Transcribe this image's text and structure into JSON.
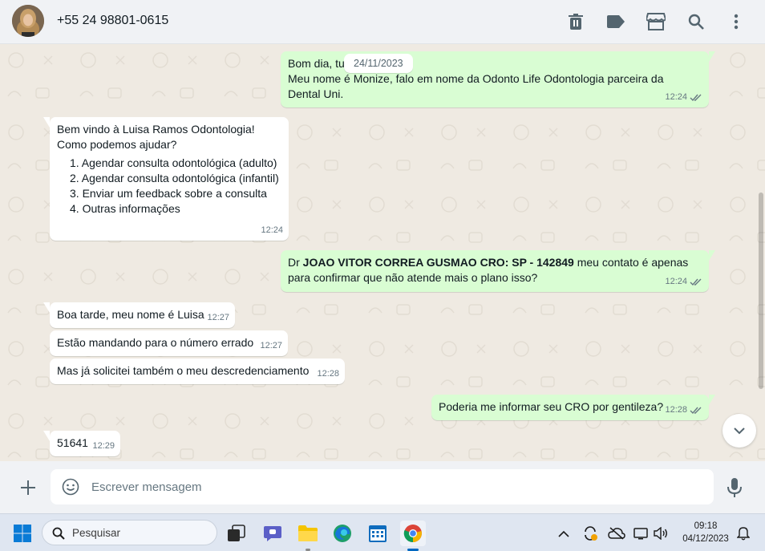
{
  "header": {
    "contact_name": "+55 24 98801-0615"
  },
  "chat": {
    "date_label": "24/11/2023",
    "messages": [
      {
        "dir": "out",
        "lines": [
          "Bom dia, tu",
          "Meu nome é Monize, falo em nome da Odonto Life Odontologia parceira da",
          "Dental Uni."
        ],
        "time": "12:24",
        "ticks": "read"
      },
      {
        "dir": "in",
        "lines": [
          "Bem vindo à Luisa Ramos Odontologia!",
          "Como podemos ajudar?"
        ],
        "list": [
          "1. Agendar consulta odontológica (adulto)",
          "2. Agendar consulta odontológica (infantil)",
          "3. Enviar um feedback sobre a consulta",
          "4. Outras informações"
        ],
        "time": "12:24"
      },
      {
        "dir": "out",
        "prefix": "Dr ",
        "bold": "JOAO VITOR CORREA GUSMAO CRO: SP - 142849",
        "suffix": " meu contato é apenas",
        "line2": "para confirmar que não atende mais o plano isso?",
        "time": "12:24",
        "ticks": "read"
      },
      {
        "dir": "in",
        "text": "Boa tarde, meu nome é Luisa",
        "time": "12:27"
      },
      {
        "dir": "in",
        "text": "Estão mandando para o número errado",
        "time": "12:27"
      },
      {
        "dir": "in",
        "text": "Mas já solicitei também o meu descredenciamento",
        "time": "12:28"
      },
      {
        "dir": "out",
        "text": "Poderia me informar seu CRO por gentileza?",
        "time": "12:28",
        "ticks": "read"
      },
      {
        "dir": "in",
        "text": "51641",
        "time": "12:29"
      }
    ]
  },
  "composer": {
    "placeholder": "Escrever mensagem"
  },
  "taskbar": {
    "search_label": "Pesquisar",
    "time": "09:18",
    "date": "04/12/2023"
  },
  "colors": {
    "incoming_bubble": "#ffffff",
    "outgoing_bubble": "#d9fdd3",
    "read_tick": "#667781",
    "header_bg": "#f0f2f5"
  },
  "icons": {
    "header": [
      "trash-icon",
      "label-icon",
      "store-icon",
      "search-icon",
      "more-icon"
    ],
    "taskbar": [
      "windows-start-icon",
      "search-icon",
      "task-view-icon",
      "teams-chat-icon",
      "file-explorer-icon",
      "edge-icon",
      "calendar-icon",
      "chrome-icon"
    ],
    "tray": [
      "chevron-up-icon",
      "sync-icon",
      "onedrive-icon",
      "monitor-icon",
      "speaker-icon",
      "notification-bell-icon"
    ]
  }
}
